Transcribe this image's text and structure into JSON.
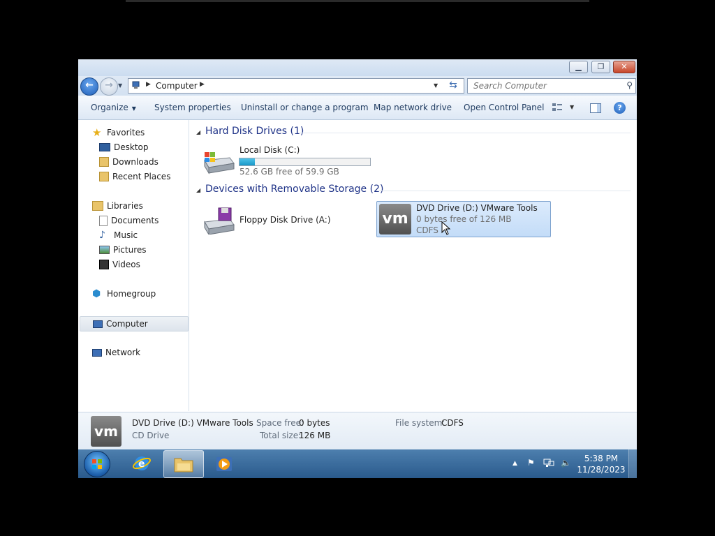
{
  "address": {
    "crumb": "Computer"
  },
  "search": {
    "placeholder": "Search Computer"
  },
  "toolbar": {
    "organize": "Organize",
    "system_properties": "System properties",
    "uninstall": "Uninstall or change a program",
    "map_drive": "Map network drive",
    "control_panel": "Open Control Panel"
  },
  "nav": {
    "favorites": "Favorites",
    "desktop": "Desktop",
    "downloads": "Downloads",
    "recent": "Recent Places",
    "libraries": "Libraries",
    "documents": "Documents",
    "music": "Music",
    "pictures": "Pictures",
    "videos": "Videos",
    "homegroup": "Homegroup",
    "computer": "Computer",
    "network": "Network"
  },
  "groups": {
    "hdd": "Hard Disk Drives (1)",
    "removable": "Devices with Removable Storage (2)"
  },
  "drives": {
    "c": {
      "name": "Local Disk (C:)",
      "free": "52.6 GB free of 59.9 GB",
      "used_fraction": 0.12
    },
    "a": {
      "name": "Floppy Disk Drive (A:)"
    },
    "d": {
      "name": "DVD Drive (D:) VMware Tools",
      "free": "0 bytes free of 126 MB",
      "fs": "CDFS",
      "logo": "vm"
    }
  },
  "details": {
    "name": "DVD Drive (D:) VMware Tools",
    "type": "CD Drive",
    "space_free_label": "Space free:",
    "space_free": "0 bytes",
    "total_size_label": "Total size:",
    "total_size": "126 MB",
    "fs_label": "File system:",
    "fs": "CDFS",
    "logo": "vm"
  },
  "taskbar": {
    "time": "5:38 PM",
    "date": "11/28/2023"
  },
  "colors": {
    "group_header": "#1e3287",
    "selection": "#c3dcf8",
    "taskbar": "#2a5a8c"
  }
}
